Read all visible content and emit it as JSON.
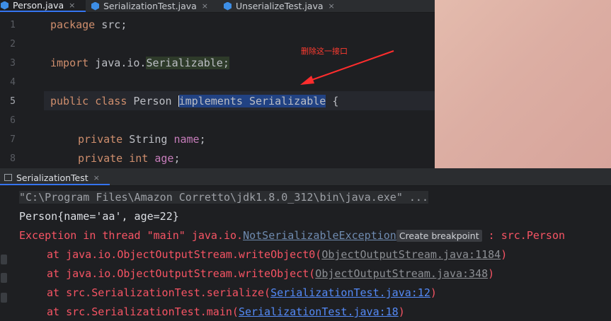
{
  "tabs": [
    {
      "label": "Person.java",
      "active": true
    },
    {
      "label": "SerializationTest.java",
      "active": false
    },
    {
      "label": "UnserializeTest.java",
      "active": false
    }
  ],
  "tab_close": "×",
  "editor": {
    "line_numbers": [
      "1",
      "2",
      "3",
      "4",
      "5",
      "6",
      "7",
      "8"
    ],
    "current_line": "5",
    "line1": {
      "kw": "package",
      "rest": " src;"
    },
    "line3": {
      "kw": "import",
      "pkg": " java.io.",
      "cls": "Serializable",
      "semi": ";"
    },
    "line5": {
      "kw1": "public",
      "kw2": " class",
      "name": " Person ",
      "sel1": "implements",
      "sel2": " Serializable",
      "brace": " {"
    },
    "line7": {
      "kw": "private",
      "type": " String ",
      "field": "name",
      "semi": ";"
    },
    "line8": {
      "kw": "private",
      "type": " int ",
      "field": "age",
      "semi": ";"
    }
  },
  "annotation": "删除这一接口",
  "run": {
    "tab_label": "SerializationTest",
    "line_cmd": "\"C:\\Program Files\\Amazon Corretto\\jdk1.8.0_312\\bin\\java.exe\" ...",
    "line_out": "Person{name='aa', age=22}",
    "line_ex_prefix": "Exception in thread \"main\" java.io.",
    "line_ex_name": "NotSerializableException",
    "line_ex_tooltip": "Create breakpoint",
    "line_ex_suffix": " : src.Person",
    "st1_pre": "at java.io.ObjectOutputStream.writeObject0(",
    "st1_link": "ObjectOutputStream.java:1184",
    "st2_pre": "at java.io.ObjectOutputStream.writeObject(",
    "st2_link": "ObjectOutputStream.java:348",
    "st3_pre": "at src.SerializationTest.serialize(",
    "st3_link": "SerializationTest.java:12",
    "st4_pre": "at src.SerializationTest.main(",
    "st4_link": "SerializationTest.java:18",
    "close_paren": ")"
  },
  "colors": {
    "accent": "#3574f0",
    "error": "#f75464",
    "link": "#548af7",
    "annotation": "#ff3b30"
  }
}
